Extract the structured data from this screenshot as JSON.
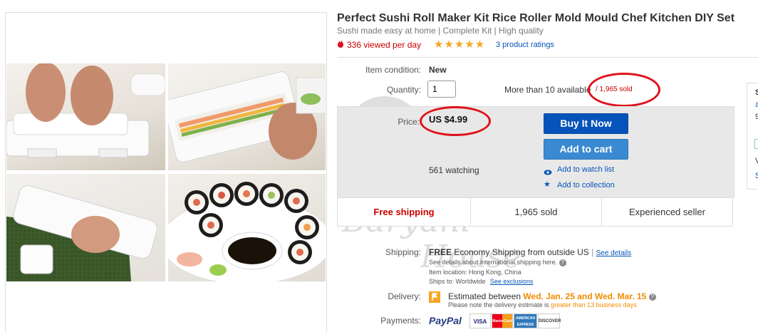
{
  "product": {
    "title": "Perfect Sushi Roll Maker Kit Rice Roller Mold Mould Chef Kitchen DIY Set",
    "subtitle": "Sushi made easy at home | Complete Kit | High quality",
    "hot_text": "336 viewed per day",
    "rating_stars": 5,
    "ratings_link": "3 product ratings"
  },
  "details": {
    "condition_label": "Item condition:",
    "condition_value": "New",
    "quantity_label": "Quantity:",
    "quantity_value": "1",
    "available_text": "More than 10 available",
    "sold_text": "/ 1,965 sold"
  },
  "buy": {
    "price_label": "Price:",
    "price_value": "US $4.99",
    "buy_now": "Buy It Now",
    "add_to_cart": "Add to cart",
    "watching": "561 watching",
    "add_watch": "Add to watch list",
    "add_collection": "Add to collection"
  },
  "footer": {
    "shipping": "Free shipping",
    "sold": "1,965 sold",
    "seller": "Experienced seller"
  },
  "shipping": {
    "label": "Shipping:",
    "free": "FREE",
    "method": "Economy Shipping from outside US",
    "see_details": "See details",
    "intl_note": "See details about international shipping here.",
    "item_location": "Item location:  Hong Kong, China",
    "ships_to": "Ships to:  Worldwide",
    "see_exclusions": "See exclusions"
  },
  "delivery": {
    "label": "Delivery:",
    "estimated_prefix": "Estimated between",
    "dates": "Wed. Jan. 25 and Wed. Mar. 15",
    "note_prefix": "Please note the delivery estimate is",
    "note_highlight": "greater than 13 business days."
  },
  "payments": {
    "label": "Payments:",
    "paypal": "PayPal",
    "cards": [
      "VISA",
      "MasterCard",
      "AMERICAN EXPRESS",
      "DISCOVER"
    ]
  },
  "right_panel": [
    "S",
    "a",
    "9",
    "V",
    "S"
  ],
  "watermark": [
    "mama",
    "Baryani",
    "House"
  ],
  "colors": {
    "accent_blue": "#0654ba",
    "cart_blue": "#3a8ad1",
    "alert_red": "#c00",
    "star_orange": "#f5a623",
    "highlight_orange": "#f08c00"
  }
}
